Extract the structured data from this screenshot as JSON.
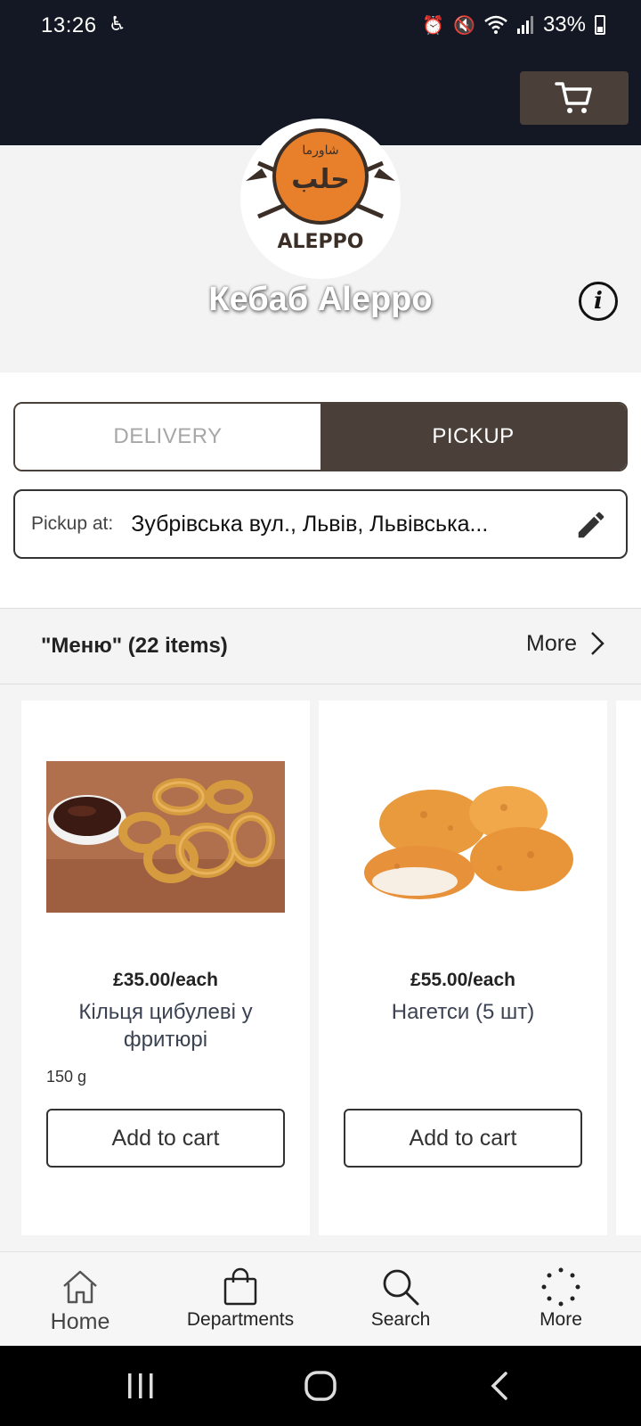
{
  "status_bar": {
    "time": "13:26",
    "battery": "33%",
    "icons": [
      "accessibility-icon",
      "alarm-icon",
      "mute-icon",
      "wifi-icon",
      "signal-icon",
      "battery-icon"
    ]
  },
  "header": {
    "background": "#141824",
    "cart_button_color": "#4a4039"
  },
  "store": {
    "name": "Кебаб Aleppo",
    "logo_text": "ALEPPO",
    "logo_arabic": "حلب",
    "logo_arabic_small": "شاورما"
  },
  "mode_toggle": {
    "delivery_label": "DELIVERY",
    "pickup_label": "PICKUP",
    "selected": "PICKUP"
  },
  "pickup": {
    "label": "Pickup at:",
    "address": "Зубрівська вул., Львів, Львівська..."
  },
  "section": {
    "title": "\"Меню\" (22 items)",
    "more_label": "More"
  },
  "products": [
    {
      "price": "£35.00/each",
      "title": "Кільця цибулеві у фритюрі",
      "weight": "150 g",
      "button": "Add to cart",
      "image": "onion-rings-photo"
    },
    {
      "price": "£55.00/each",
      "title": "Нагетси (5 шт)",
      "weight": "",
      "button": "Add to cart",
      "image": "nuggets-photo"
    }
  ],
  "bottom_nav": [
    {
      "label": "Home",
      "icon": "home-icon"
    },
    {
      "label": "Departments",
      "icon": "shopping-bag-icon"
    },
    {
      "label": "Search",
      "icon": "search-icon"
    },
    {
      "label": "More",
      "icon": "more-dots-icon"
    }
  ]
}
